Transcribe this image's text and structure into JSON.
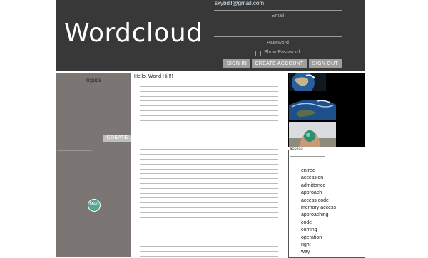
{
  "header": {
    "logo_text": "Wordcloud",
    "email_value": "skybdll@gmail.com",
    "email_label": "Email",
    "password_label": "Password",
    "show_password_label": "Show Password",
    "sign_in": "SIGN IN",
    "create_account": "CREATE ACCOUNT",
    "sign_out": "SIGN OUT"
  },
  "sidebar": {
    "title": "Topics",
    "create_button": "CREATE",
    "node_label": "Main"
  },
  "main": {
    "greeting": "Hello, World Hi!!!!"
  },
  "words": {
    "title": "access",
    "items": [
      "entree",
      "accession",
      "admittance",
      "approach",
      "access code",
      "memory access",
      "approaching",
      "code",
      "coming",
      "operation",
      "right",
      "way"
    ]
  },
  "colors": {
    "header_bg": "#383838",
    "sidebar_bg": "#7b7674",
    "node_color": "#56a693",
    "button_bg": "#9e9e9e"
  }
}
